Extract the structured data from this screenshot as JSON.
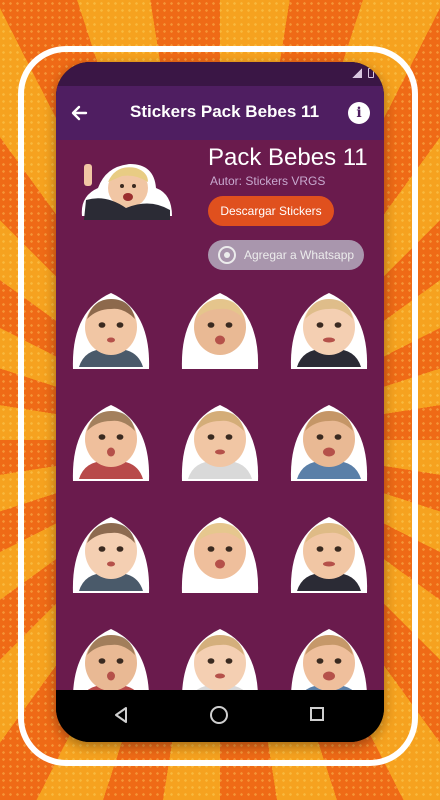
{
  "app": {
    "title": "Stickers Pack Bebes 11"
  },
  "pack": {
    "name": "Pack Bebes 11",
    "author": "Autor: Stickers VRGS",
    "download_label": "Descargar Stickers",
    "whatsapp_label": "Agregar a Whatsapp"
  },
  "stickers": [
    {
      "name": "baby-sticker-1"
    },
    {
      "name": "baby-sticker-2"
    },
    {
      "name": "baby-sticker-3"
    },
    {
      "name": "baby-sticker-4"
    },
    {
      "name": "baby-sticker-5"
    },
    {
      "name": "baby-sticker-6"
    },
    {
      "name": "baby-sticker-7"
    },
    {
      "name": "baby-sticker-8"
    },
    {
      "name": "baby-sticker-9"
    },
    {
      "name": "baby-sticker-10"
    },
    {
      "name": "baby-sticker-11"
    },
    {
      "name": "baby-sticker-12"
    }
  ],
  "icons": {
    "back": "arrow-left-icon",
    "info": "info-icon",
    "whatsapp": "whatsapp-icon",
    "nav_back": "triangle-back-icon",
    "nav_home": "circle-home-icon",
    "nav_recent": "square-recent-icon"
  },
  "colors": {
    "appbar": "#4f1e61",
    "content_bg": "#6a1b4d",
    "download_button": "#e0501e",
    "whatsapp_button": "#a996ad",
    "background_orange": "#f07a1a"
  }
}
